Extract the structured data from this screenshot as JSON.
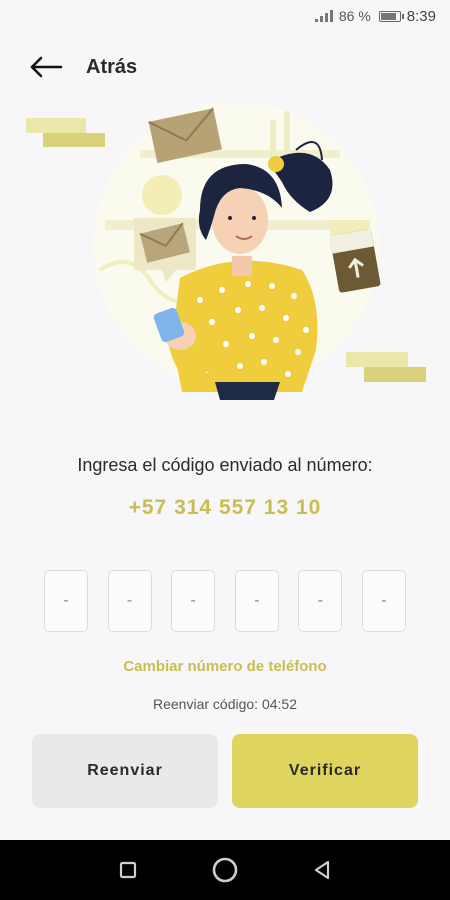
{
  "status_bar": {
    "battery_percent": "86 %",
    "battery_level": 0.86,
    "time": "8:39"
  },
  "header": {
    "back_icon": "arrow-left-icon",
    "title": "Atrás"
  },
  "illustration": {
    "description_icon": "woman-with-phone-illustration"
  },
  "verification": {
    "prompt": "Ingresa el código enviado al número:",
    "phone_number": "+57 314 557 13 10",
    "code_placeholder": "-",
    "code_boxes": [
      "-",
      "-",
      "-",
      "-",
      "-",
      "-"
    ],
    "change_number_link": "Cambiar número de teléfono",
    "resend_timer": "Reenviar código: 04:52"
  },
  "buttons": {
    "resend_label": "Reenviar",
    "verify_label": "Verificar"
  },
  "nav_bar": {
    "icons": [
      "square-recents-icon",
      "circle-home-icon",
      "triangle-back-icon"
    ]
  },
  "colors": {
    "accent": "#c9bd52",
    "verify_button": "#dfd45e",
    "resend_button": "#e9e9eb",
    "background": "#f7f7f9"
  }
}
